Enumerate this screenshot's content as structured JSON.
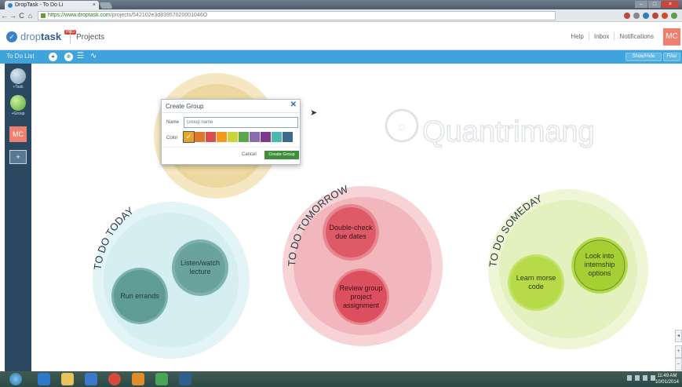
{
  "browser": {
    "tab_title": "DropTask - To Do Li",
    "tab_close": "×",
    "url_host": "https://www.droptask.com",
    "url_path": "/projects/542102e3d83957020001046O",
    "nav": [
      "←",
      "→",
      "C",
      "⌂"
    ],
    "extension_icons": [
      "opera-icon",
      "star-icon",
      "skype-icon",
      "circle-icon",
      "record-icon",
      "evernote-icon"
    ],
    "window_controls": [
      "–",
      "□",
      "×"
    ]
  },
  "app": {
    "logo_text_plain": "drop",
    "logo_text_bold": "task",
    "logo_badge": "PRO",
    "section": "Projects",
    "links": [
      "Help",
      "Inbox",
      "Notifications"
    ],
    "avatar_initials": "MC"
  },
  "toolbar": {
    "list_name": "To Do List",
    "showhide_label": "Show/Hide",
    "filter_label": "Filter"
  },
  "sidebar": {
    "task_label": "+Task",
    "group_label": "+Group",
    "avatar_initials": "MC",
    "add_person": "+"
  },
  "groups": [
    {
      "label": "TO DO TODAY",
      "tasks": [
        {
          "label_lines": [
            "Listen/watch",
            "lecture"
          ]
        },
        {
          "label_lines": [
            "Run errands"
          ]
        }
      ]
    },
    {
      "label": "TO DO TOMORROW",
      "tasks": [
        {
          "label_lines": [
            "Double-check",
            "due dates"
          ]
        },
        {
          "label_lines": [
            "Review group",
            "project",
            "assignment"
          ]
        }
      ]
    },
    {
      "label": "TO DO SOMEDAY",
      "tasks": [
        {
          "label_lines": [
            "Look into",
            "internship",
            "options"
          ]
        },
        {
          "label_lines": [
            "Learn morse",
            "code"
          ]
        }
      ]
    }
  ],
  "watermark": {
    "text": "Quantrimang"
  },
  "dialog": {
    "title": "Create Group",
    "close": "✕",
    "name_label": "Name",
    "name_placeholder": "Group name",
    "color_label": "Color",
    "swatches": [
      "#e3a62b",
      "#e0762c",
      "#dc4d4d",
      "#f29a1e",
      "#c9d63a",
      "#5aa649",
      "#8a6bb2",
      "#7a3b8c",
      "#4db8b0",
      "#3d6a8a"
    ],
    "selected_mark": "✓",
    "cancel_label": "Cancel",
    "create_label": "Create Group"
  },
  "canvas_controls": [
    "◂",
    "+",
    "–"
  ],
  "taskbar": {
    "clock_time": "11:49 AM",
    "clock_date": "10/01/2014"
  }
}
